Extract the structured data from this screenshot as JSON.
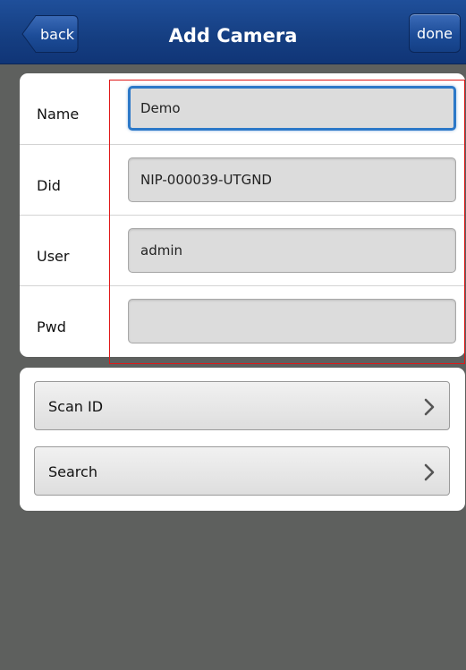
{
  "nav": {
    "back_label": "back",
    "title": "Add Camera",
    "done_label": "done"
  },
  "form": {
    "fields": [
      {
        "label": "Name",
        "value": "Demo"
      },
      {
        "label": "Did",
        "value": "NIP-000039-UTGND"
      },
      {
        "label": "User",
        "value": "admin"
      },
      {
        "label": "Pwd",
        "value": ""
      }
    ]
  },
  "actions": [
    {
      "label": "Scan ID",
      "icon": "chevron-right-icon"
    },
    {
      "label": "Search",
      "icon": "chevron-right-icon"
    }
  ],
  "colors": {
    "navbar": "#153e81",
    "background": "#5e605e",
    "focus_ring": "#2c78c8",
    "highlight_frame": "#e01818"
  }
}
